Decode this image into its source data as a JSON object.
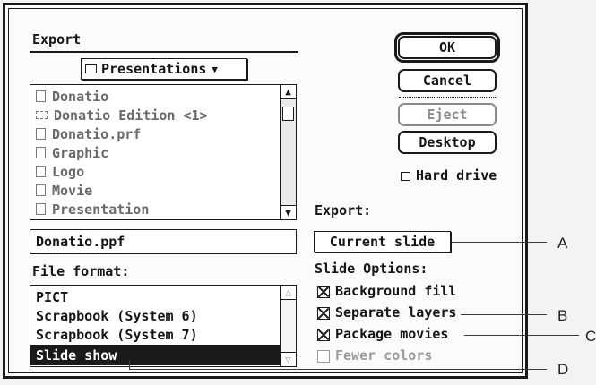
{
  "dialog": {
    "title": "Export",
    "folder_popup": "Presentations",
    "files": [
      {
        "name": "Donatio",
        "dim": true
      },
      {
        "name": "Donatio Edition <1>",
        "dim": true
      },
      {
        "name": "Donatio.prf",
        "dim": true
      },
      {
        "name": "Graphic",
        "dim": true
      },
      {
        "name": "Logo",
        "dim": true
      },
      {
        "name": "Movie",
        "dim": true
      },
      {
        "name": "Presentation",
        "dim": true
      }
    ],
    "filename_value": "Donatio.ppf",
    "file_format_label": "File format:",
    "formats": [
      {
        "name": "PICT",
        "selected": false
      },
      {
        "name": "Scrapbook (System 6)",
        "selected": false
      },
      {
        "name": "Scrapbook (System 7)",
        "selected": false
      },
      {
        "name": "Slide show",
        "selected": true
      }
    ]
  },
  "buttons": {
    "ok": "OK",
    "cancel": "Cancel",
    "eject": "Eject",
    "desktop": "Desktop"
  },
  "volume": "Hard drive",
  "export_section": {
    "label": "Export:",
    "popup": "Current slide"
  },
  "slide_options": {
    "label": "Slide Options:",
    "items": [
      {
        "label": "Background fill",
        "checked": true,
        "enabled": true
      },
      {
        "label": "Separate layers",
        "checked": true,
        "enabled": true
      },
      {
        "label": "Package movies",
        "checked": true,
        "enabled": true
      },
      {
        "label": "Fewer colors",
        "checked": false,
        "enabled": false
      }
    ]
  },
  "callouts": [
    "A",
    "B",
    "C",
    "D"
  ]
}
